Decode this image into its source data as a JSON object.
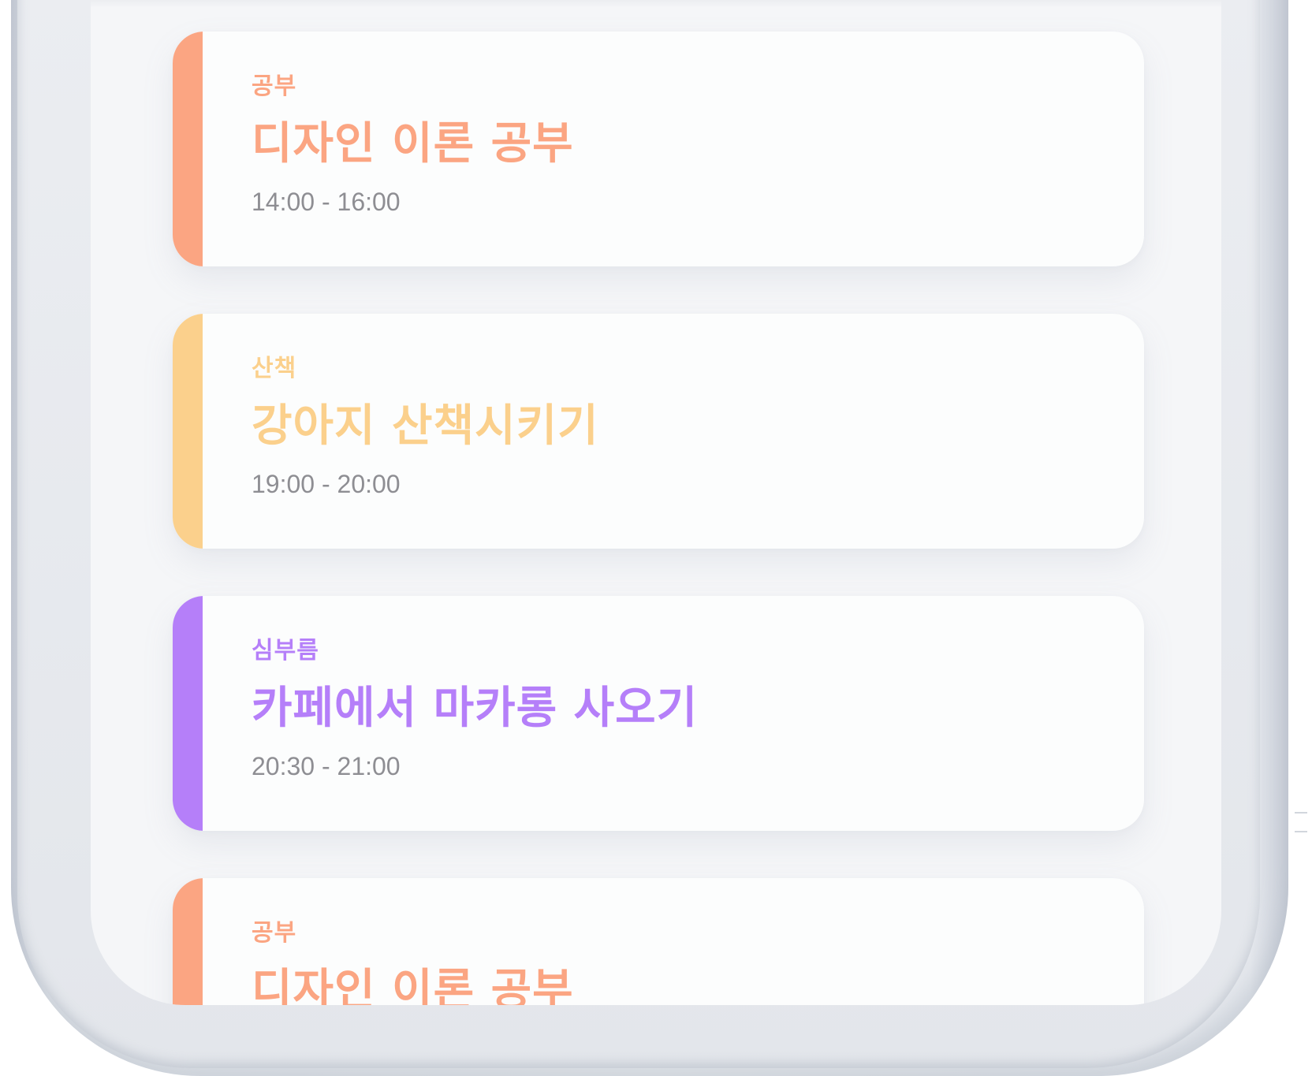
{
  "colors": {
    "study": "#fba582",
    "walk": "#fbd08c",
    "errand": "#b57ff9",
    "time_text": "#8e8e93"
  },
  "schedule": {
    "items": [
      {
        "category": "공부",
        "title": "디자인 이론 공부",
        "time": "14:00 - 16:00",
        "color": "#fba582"
      },
      {
        "category": "산책",
        "title": "강아지 산책시키기",
        "time": "19:00 - 20:00",
        "color": "#fbd08c"
      },
      {
        "category": "심부름",
        "title": "카페에서 마카롱 사오기",
        "time": "20:30 - 21:00",
        "color": "#b57ff9"
      },
      {
        "category": "공부",
        "title": "디자인 이론 공부",
        "time": "",
        "color": "#fba582"
      }
    ]
  }
}
